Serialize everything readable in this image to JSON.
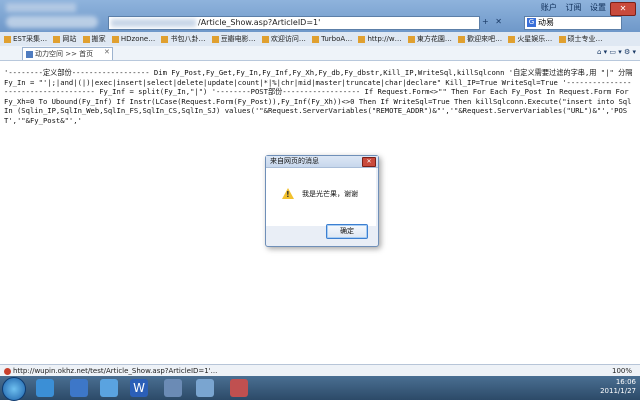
{
  "browser": {
    "address_suffix": "/Article_Show.asp?ArticleID=1'",
    "search_engine_label": "动易",
    "menu": [
      "账户",
      "订阅",
      "设置"
    ],
    "nav_buttons": [
      "+",
      "✕"
    ],
    "close_button": "✕"
  },
  "favorites": [
    "EST采集…",
    "网站",
    "搬家",
    "HDzone…",
    "书包八卦…",
    "豆瓣电影…",
    "欢迎访问…",
    "TurboA…",
    "http://w…",
    "東方花園…",
    "歡迎來吧…",
    "火星娱乐…",
    "硕士专业…"
  ],
  "tab": {
    "label": "动力空间 >> 首页"
  },
  "page": {
    "code_text": "'--------定义部份------------------ Dim Fy_Post,Fy_Get,Fy_In,Fy_Inf,Fy_Xh,Fy_db,Fy_dbstr,Kill_IP,WriteSql,killSqlconn '自定义需要过滤的字串,用 \"|\" 分隔 Fy_In = \"'|;|and|(|)|exec|insert|select|delete|update|count|*|%|chr|mid|master|truncate|char|declare\" Kill_IP=True WriteSql=True '------------------------------------ Fy_Inf = split(Fy_In,\"|\") '--------POST部份------------------ If Request.Form<>\"\" Then For Each Fy_Post In Request.Form For Fy_Xh=0 To Ubound(Fy_Inf) If Instr(LCase(Request.Form(Fy_Post)),Fy_Inf(Fy_Xh))<>0 Then If WriteSql=True Then killSqlconn.Execute(\"insert into SqlIn (Sqlin_IP,SqlIn_Web,SqlIn_FS,SqlIn_CS,SqlIn_SJ) values('\"&Request.ServerVariables(\"REMOTE_ADDR\")&\"','\"&Request.ServerVariables(\"URL\")&\"','POST','\"&Fy_Post&\"','"
  },
  "dialog": {
    "title": "来自网页的消息",
    "message": "我是光芒果，谢谢",
    "ok_label": "确定",
    "icon": "warning-icon"
  },
  "statusbar": {
    "text": "http://wupin.okhz.net/test/Article_Show.asp?ArticleID=1'...",
    "zoom": "100%"
  },
  "taskbar": {
    "time": "16:06",
    "date": "2011/1/27"
  }
}
